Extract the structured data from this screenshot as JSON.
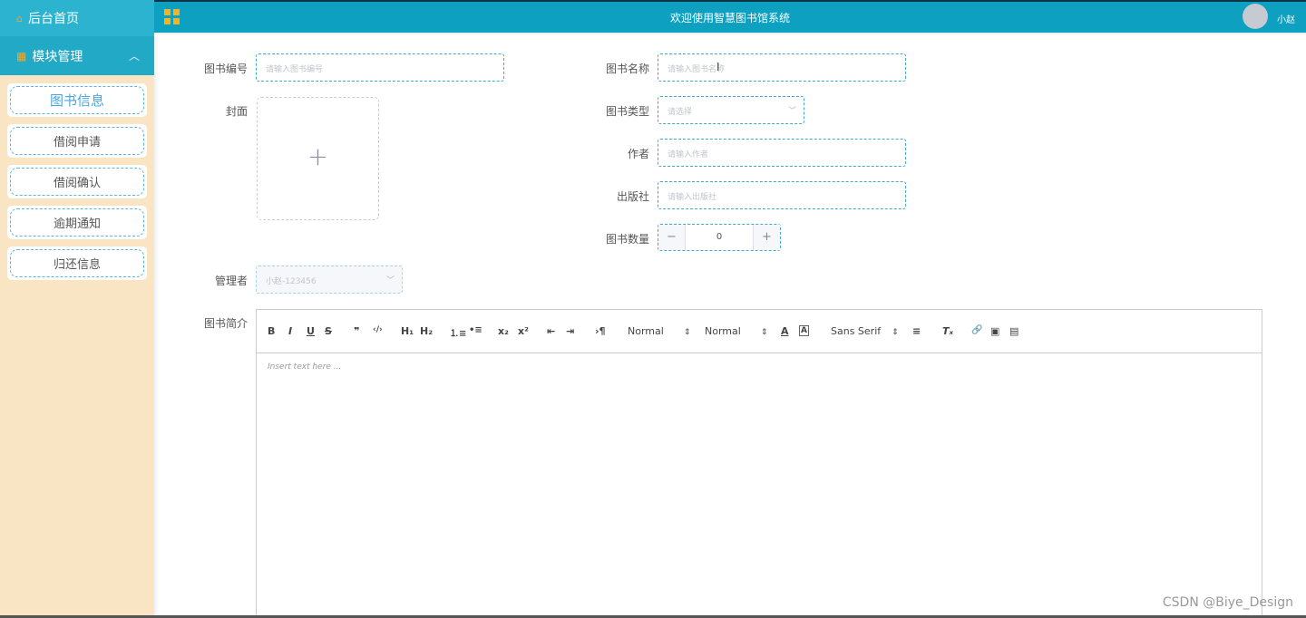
{
  "sidebar": {
    "home_label": "后台首页",
    "module_label": "模块管理",
    "items": [
      {
        "label": "图书信息"
      },
      {
        "label": "借阅申请"
      },
      {
        "label": "借阅确认"
      },
      {
        "label": "逾期通知"
      },
      {
        "label": "归还信息"
      }
    ]
  },
  "header": {
    "title": "欢迎使用智慧图书馆系统",
    "user": "小赵"
  },
  "form": {
    "book_no_label": "图书编号",
    "book_no_placeholder": "请输入图书编号",
    "book_name_label": "图书名称",
    "book_name_placeholder": "请输入图书名称",
    "cover_label": "封面",
    "upload_plus": "+",
    "book_type_label": "图书类型",
    "book_type_placeholder": "请选择",
    "author_label": "作者",
    "author_placeholder": "请输入作者",
    "publisher_label": "出版社",
    "publisher_placeholder": "请输入出版社",
    "quantity_label": "图书数量",
    "quantity_value": "0",
    "quantity_minus": "−",
    "quantity_plus": "+",
    "manager_label": "管理者",
    "manager_value": "小赵-123456",
    "intro_label": "图书简介"
  },
  "editor": {
    "bold": "B",
    "italic": "I",
    "underline": "U",
    "strike": "S",
    "quote": "❞",
    "code": "‹/›",
    "h1": "H₁",
    "h2": "H₂",
    "ordered_list": "⒈≡",
    "bullet_list": "•≡",
    "sub": "x₂",
    "sup": "x²",
    "outdent": "⇤",
    "indent": "⇥",
    "direction": "›¶",
    "size_select": "Normal",
    "header_select": "Normal",
    "font_color": "A",
    "background_color": "A",
    "font_select": "Sans Serif",
    "align": "≡",
    "clean": "Tₓ",
    "link": "🔗",
    "image": "▣",
    "video": "▤",
    "placeholder": "Insert text here ..."
  },
  "watermark": "CSDN @Biye_Design",
  "colors": {
    "sidebar_bg": "#f9e4c4",
    "header_bg": "#0ea0c0",
    "accent": "#3fa8d4",
    "icon_accent": "#f6a623"
  }
}
